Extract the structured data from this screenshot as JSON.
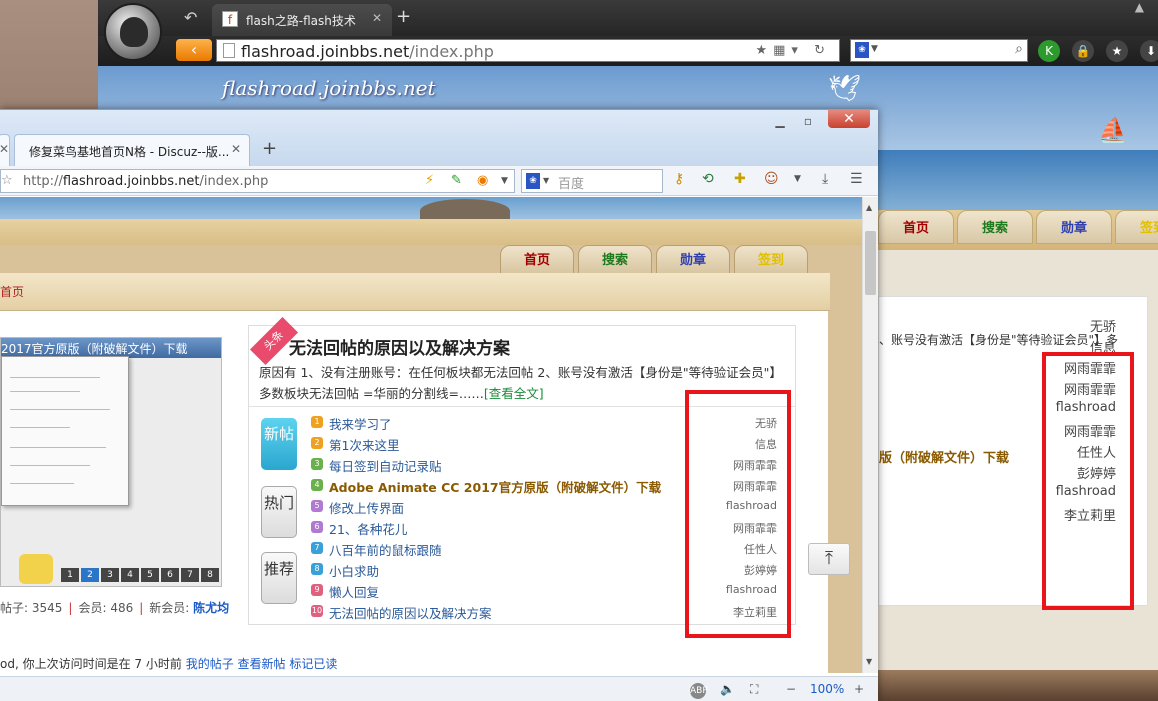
{
  "back_browser": {
    "tab_title": "flash之路-flash技术",
    "tab_favicon": "f-icon",
    "url_host": "flashroad.joinbbs.net",
    "url_path": "/index.php",
    "site_name": "flashroad.joinbbs.net",
    "nav_tabs": [
      "首页",
      "搜索",
      "勋章",
      "签到"
    ],
    "summary": "、账号没有激活【身份是\"等待验证会员\"】多",
    "headline": "版（附破解文件）下载",
    "authors": [
      "无骄",
      "信息",
      "网雨霏霏",
      "网雨霏霏",
      "flashroad",
      "网雨霏霏",
      "任性人",
      "彭婷婷",
      "flashroad",
      "李立莉里"
    ],
    "extensions": [
      "K",
      "🔒",
      "★",
      "⬇"
    ]
  },
  "front_browser": {
    "tabs": [
      {
        "title": "修复菜鸟基地首页N格 - Discuz--版..."
      }
    ],
    "url_prefix": "http://",
    "url_host": "flashroad.joinbbs.net",
    "url_path": "/index.php",
    "search_placeholder": "百度",
    "zoom": "100%",
    "page": {
      "nav_tabs": [
        "首页",
        "搜索",
        "勋章",
        "签到"
      ],
      "breadcrumb": "首页",
      "screenshot_title": "2017官方原版（附破解文件）下载",
      "stats": {
        "posts_label": "帖子:",
        "posts": "3545",
        "members_label": "会员:",
        "members": "486",
        "newmember_label": "新会员:",
        "newmember": "陈尤均"
      },
      "headline_badge": "头条",
      "headline_title": "无法回帖的原因以及解决方案",
      "headline_desc": "原因有 1、没有注册账号：在任何板块都无法回帖 2、账号没有激活【身份是\"等待验证会员\"】多数板块无法回帖 =华丽的分割线=……",
      "read_more": "[查看全文]",
      "buttons": {
        "new": "新帖",
        "hot": "热门",
        "rec": "推荐"
      },
      "threads": [
        {
          "num": "1",
          "title": "我来学习了",
          "author": "无骄"
        },
        {
          "num": "2",
          "title": "第1次来这里",
          "author": "信息"
        },
        {
          "num": "3",
          "title": "每日签到自动记录贴",
          "author": "网雨霏霏"
        },
        {
          "num": "4",
          "title": "Adobe Animate CC 2017官方原版（附破解文件）下载",
          "author": "网雨霏霏"
        },
        {
          "num": "5",
          "title": "修改上传界面",
          "author": "flashroad"
        },
        {
          "num": "6",
          "title": "21、各种花儿",
          "author": "网雨霏霏"
        },
        {
          "num": "7",
          "title": "八百年前的鼠标跟随",
          "author": "任性人"
        },
        {
          "num": "8",
          "title": "小白求助",
          "author": "彭婷婷"
        },
        {
          "num": "9",
          "title": "懒人回复",
          "author": "flashroad"
        },
        {
          "num": "10",
          "title": "无法回帖的原因以及解决方案",
          "author": "李立莉里"
        }
      ],
      "footer_text": "od, 你上次访问时间是在 7 小时前",
      "footer_links": [
        "我的帖子",
        "查看新帖",
        "标记已读"
      ]
    }
  },
  "colors": {
    "highlight_red": "#e8151b",
    "nav_home": "#a20000",
    "nav_search": "#1e7a1e",
    "nav_medal": "#2f3fb0",
    "nav_checkin": "#e0c000"
  }
}
